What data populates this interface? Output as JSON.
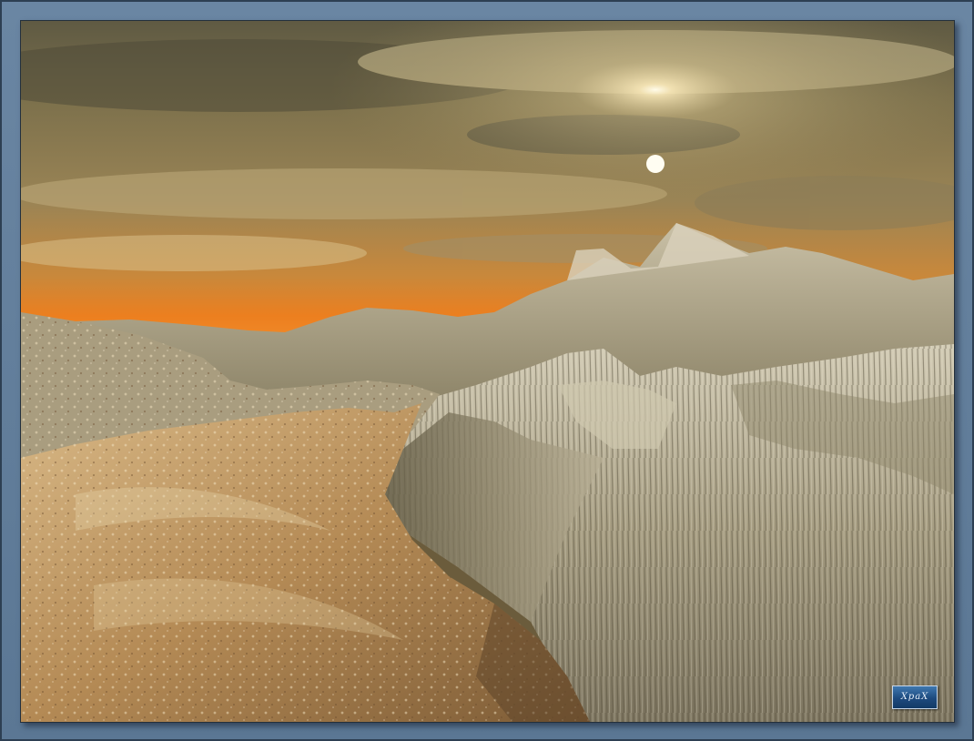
{
  "scene": {
    "subject": "rendered-landscape",
    "sky_color": "#8a7b52",
    "horizon_glow_color": "#e07a22",
    "sun_color": "#fff6d8",
    "rock_color": "#b8a988",
    "frame_color": "#5f7b98"
  },
  "watermark": {
    "text": "XpaX"
  }
}
